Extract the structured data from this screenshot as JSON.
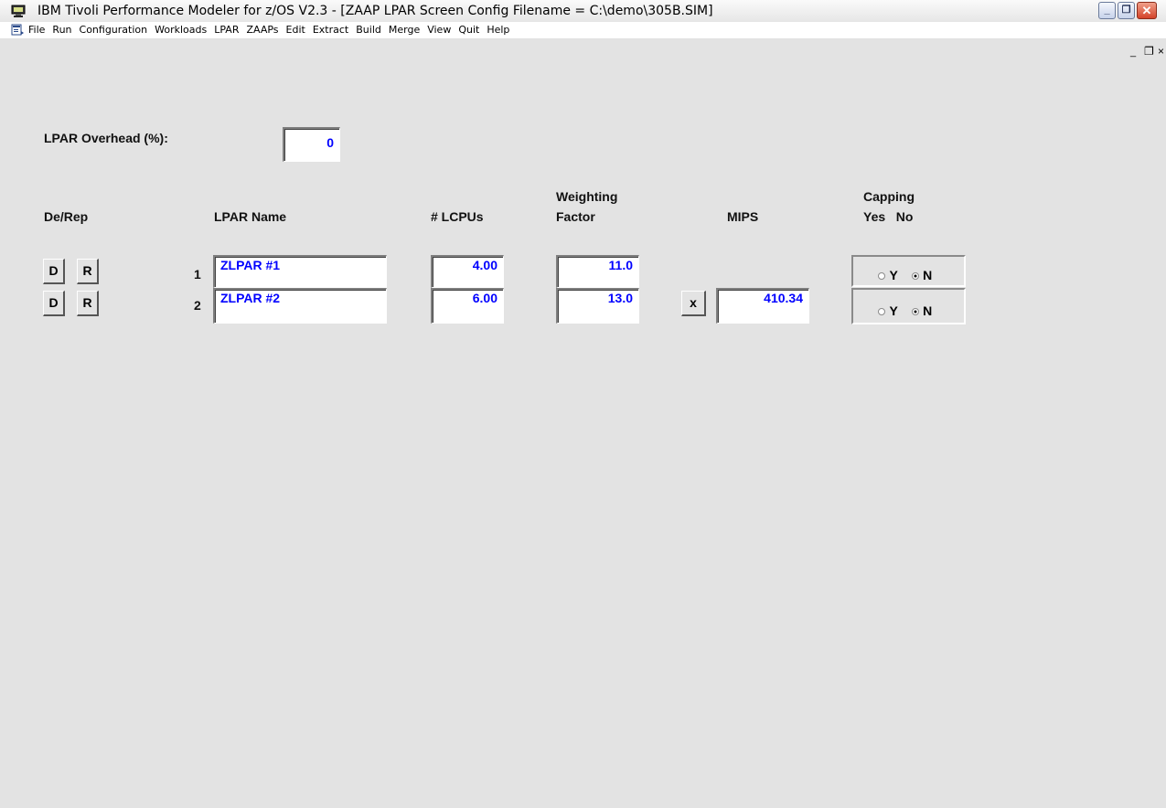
{
  "window": {
    "title": "IBM Tivoli Performance Modeler for z/OS V2.3 - [ZAAP LPAR Screen  Config Filename = C:\\demo\\305B.SIM]",
    "min_glyph": "_",
    "max_glyph": "❐",
    "close_glyph": "✕"
  },
  "menubar": {
    "items": [
      "File",
      "Run",
      "Configuration",
      "Workloads",
      "LPAR",
      "ZAAPs",
      "Edit",
      "Extract",
      "Build",
      "Merge",
      "View",
      "Quit",
      "Help"
    ],
    "mdi_min": "_",
    "mdi_restore": "❐",
    "mdi_close": "×"
  },
  "overhead": {
    "label": "LPAR Overhead (%):",
    "value": "0"
  },
  "headers": {
    "derep": "De/Rep",
    "lpar_name": "LPAR Name",
    "lcpus": "# LCPUs",
    "weighting_line1": "Weighting",
    "weighting_line2": "Factor",
    "mips": "MIPS",
    "capping_line1": "Capping",
    "capping_line2": "Yes   No"
  },
  "rows": [
    {
      "d_label": "D",
      "r_label": "R",
      "num": "1",
      "name": "ZLPAR #1",
      "lcpus": "4.00",
      "weight": "11.0",
      "y_label": "Y",
      "n_label": "N",
      "capping": "N"
    },
    {
      "d_label": "D",
      "r_label": "R",
      "num": "2",
      "name": "ZLPAR #2",
      "lcpus": "6.00",
      "weight": "13.0",
      "y_label": "Y",
      "n_label": "N",
      "capping": "N"
    }
  ],
  "mips": {
    "button_label": "x",
    "value": "410.34"
  }
}
